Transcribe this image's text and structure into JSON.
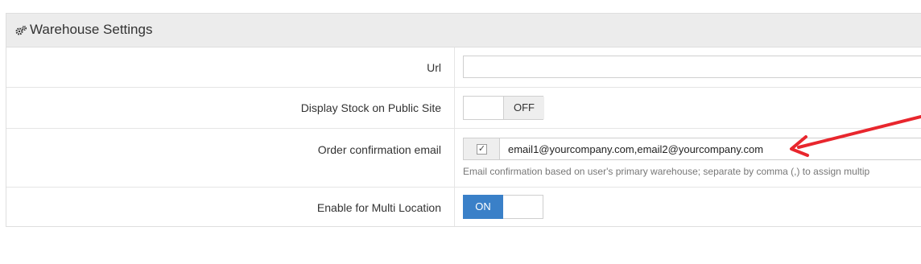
{
  "panel": {
    "title": "Warehouse Settings",
    "icon": "gears-icon"
  },
  "rows": {
    "url": {
      "label": "Url",
      "value": "",
      "placeholder": ""
    },
    "display_stock": {
      "label": "Display Stock on Public Site",
      "state": "OFF"
    },
    "order_email": {
      "label": "Order confirmation email",
      "checked": true,
      "value": "email1@yourcompany.com,email2@yourcompany.com",
      "help": "Email confirmation based on user's primary warehouse; separate by comma (,) to assign multip"
    },
    "multi_location": {
      "label": "Enable for Multi Location",
      "state": "ON"
    }
  },
  "annotation": {
    "arrow_color": "#e8262d"
  },
  "colors": {
    "accent": "#3a80c8",
    "header_bg": "#ececec"
  }
}
